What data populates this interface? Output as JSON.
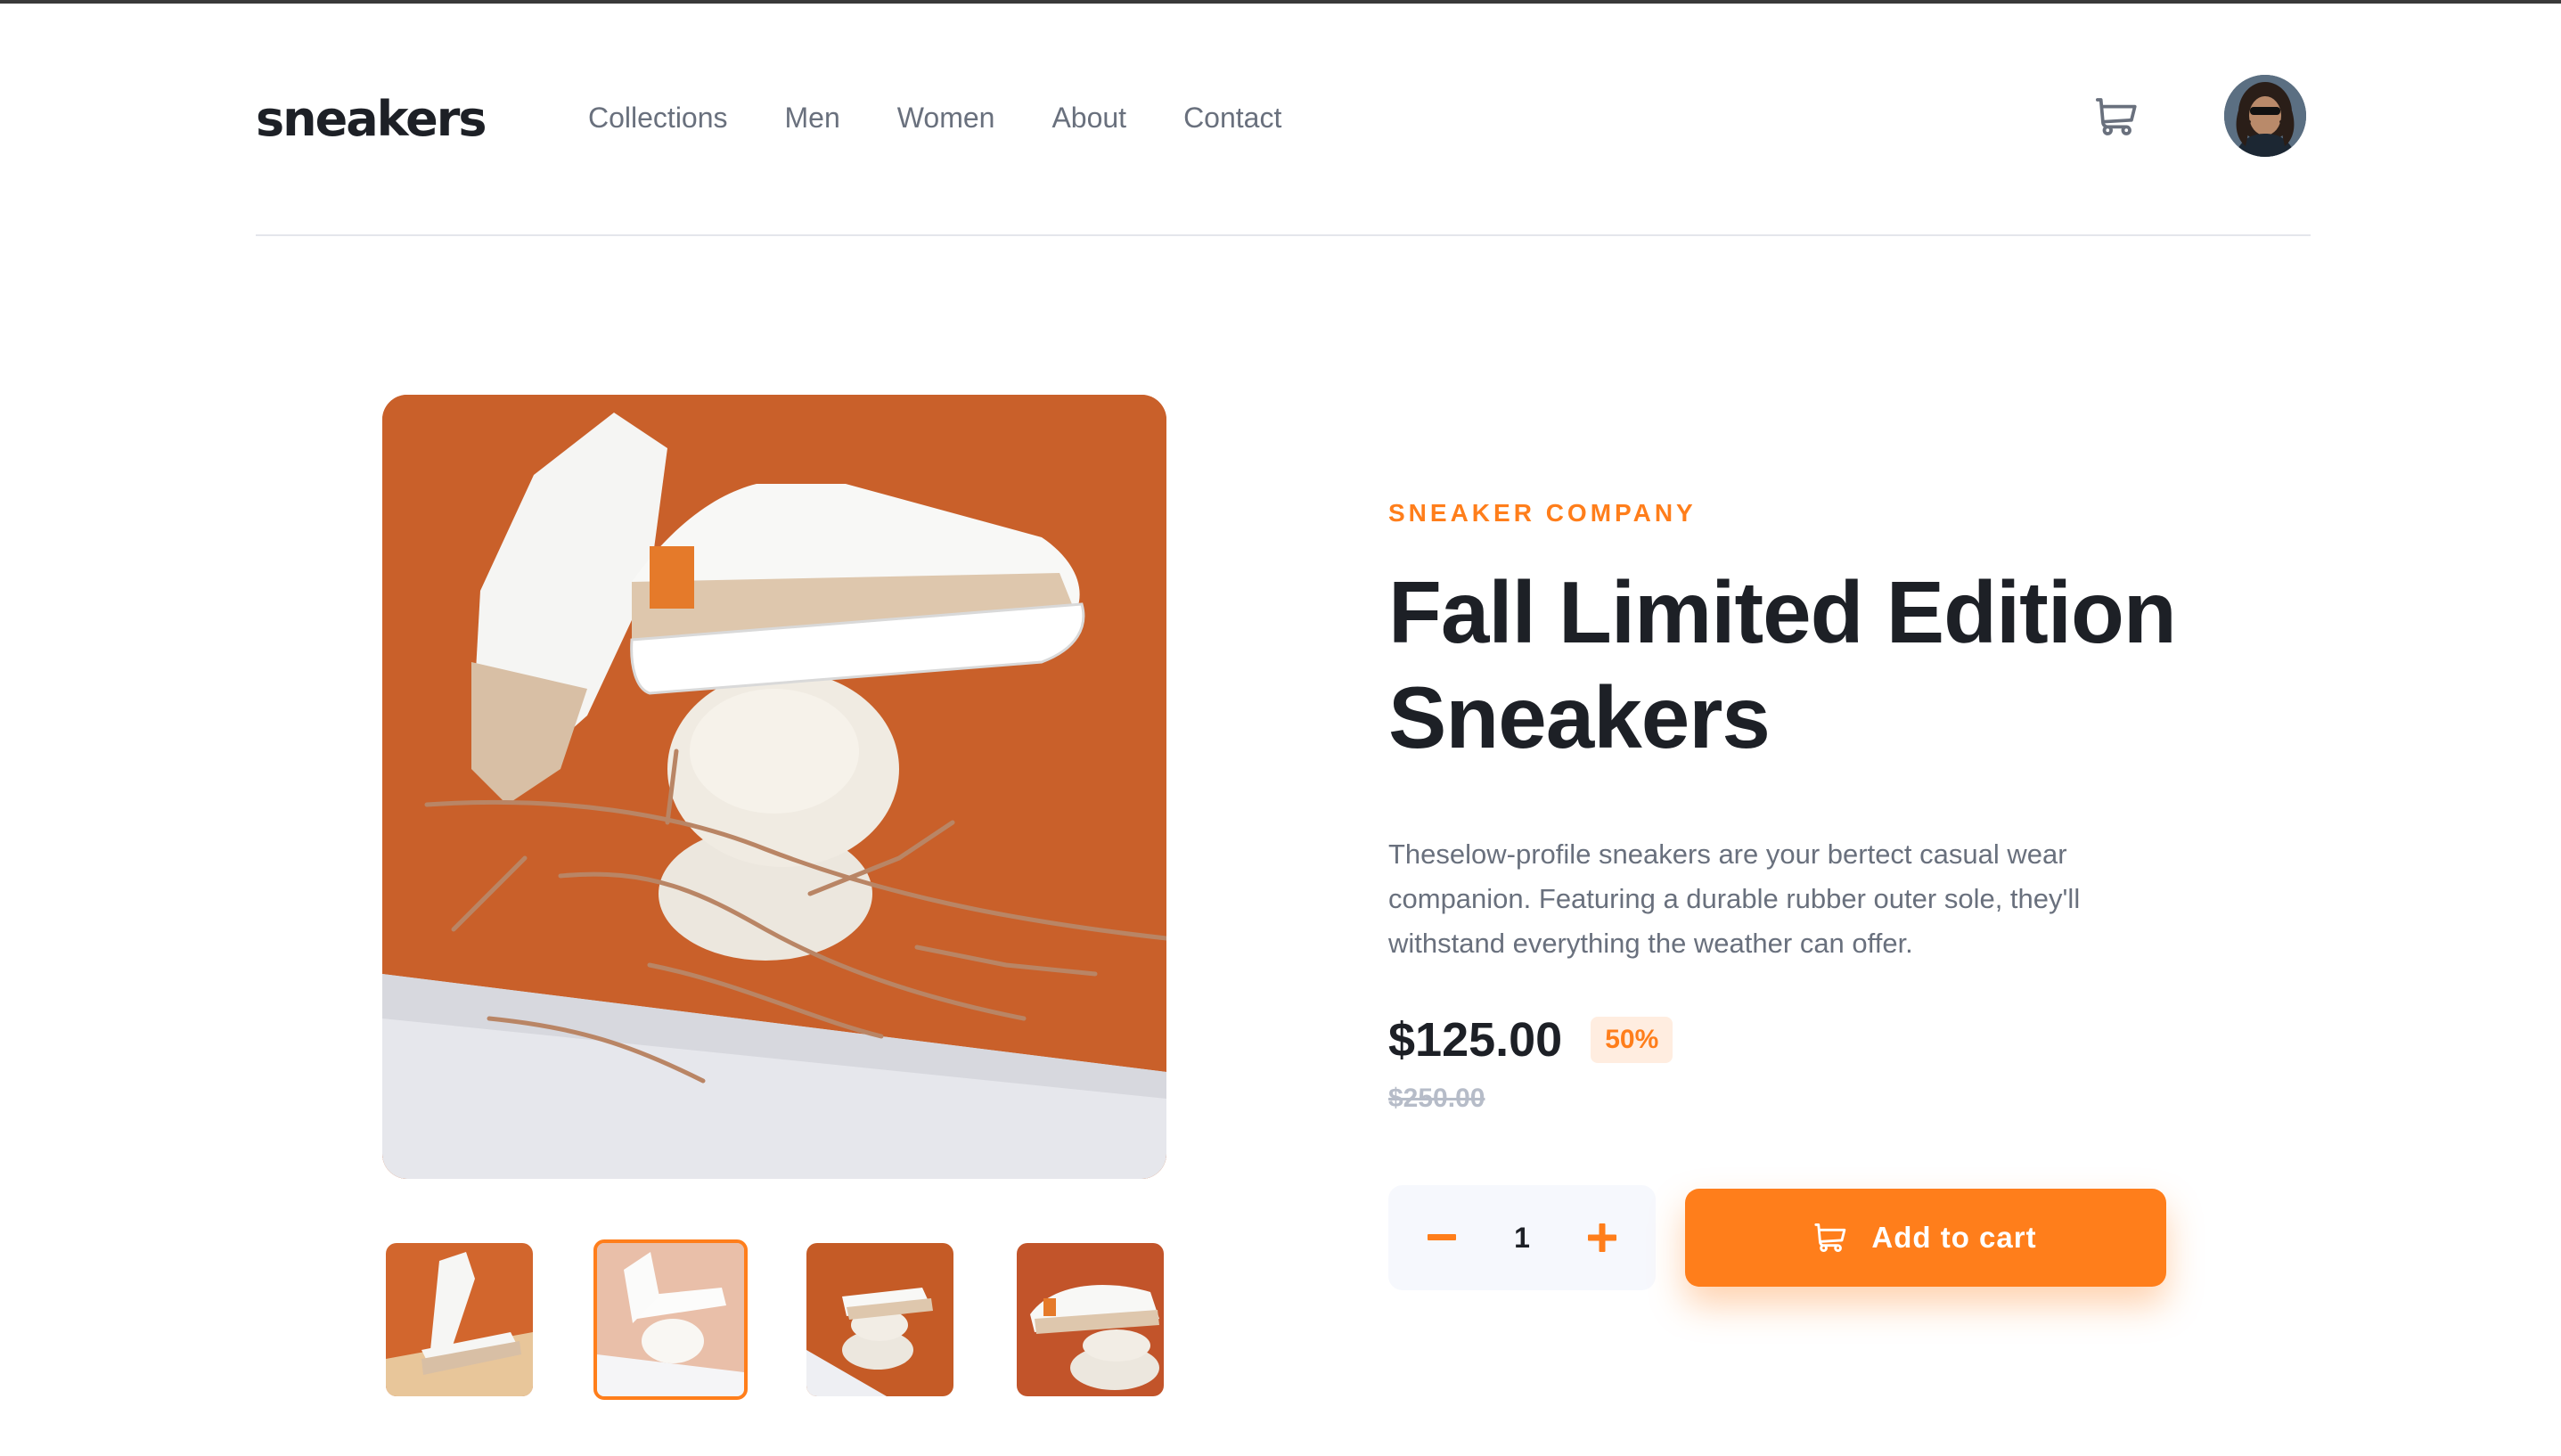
{
  "header": {
    "logo": "sneakers",
    "nav": [
      "Collections",
      "Men",
      "Women",
      "About",
      "Contact"
    ],
    "cart_icon": "cart-icon",
    "avatar_icon": "user-avatar"
  },
  "gallery": {
    "thumbnails": [
      "thumbnail-1",
      "thumbnail-2",
      "thumbnail-3",
      "thumbnail-4"
    ],
    "active_thumbnail_index": 1
  },
  "product": {
    "company": "SNEAKER COMPANY",
    "title": "Fall Limited Edition Sneakers",
    "description": "Theselow-profile sneakers are your bertect casual wear companion. Featuring a durable rubber outer sole, they'll withstand everything the weather can offer.",
    "price": "$125.00",
    "discount": "50%",
    "old_price": "$250.00",
    "quantity": "1",
    "add_to_cart_label": "Add to cart"
  },
  "colors": {
    "accent": "#ff7e1b",
    "accent_pale": "#ffede0",
    "dark": "#1d2026",
    "grey_text": "#69707d"
  }
}
